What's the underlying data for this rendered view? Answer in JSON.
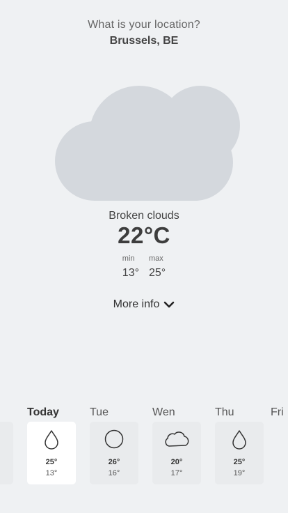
{
  "location": {
    "prompt": "What is your location?",
    "value": "Brussels, BE"
  },
  "current": {
    "icon": "cloud-icon",
    "condition": "Broken clouds",
    "temperature": "22°C",
    "min_label": "min",
    "min_value": "13°",
    "max_label": "max",
    "max_value": "25°"
  },
  "more_info": {
    "label": "More info",
    "icon": "chevron-down-icon"
  },
  "forecast": [
    {
      "day": "",
      "icon": "",
      "max": "",
      "min": ""
    },
    {
      "day": "Today",
      "icon": "raindrop-icon",
      "max": "25°",
      "min": "13°",
      "active": true
    },
    {
      "day": "Tue",
      "icon": "sun-circle-icon",
      "max": "26°",
      "min": "16°"
    },
    {
      "day": "Wen",
      "icon": "cloud-icon",
      "max": "20°",
      "min": "17°"
    },
    {
      "day": "Thu",
      "icon": "raindrop-icon",
      "max": "25°",
      "min": "19°"
    },
    {
      "day": "Fri",
      "icon": "sun-circle-icon",
      "max": "",
      "min": ""
    }
  ],
  "colors": {
    "background": "#eff1f3",
    "cloud": "#d4d8dd",
    "card": "#e9ebed",
    "card_active": "#ffffff",
    "text": "#333333"
  }
}
